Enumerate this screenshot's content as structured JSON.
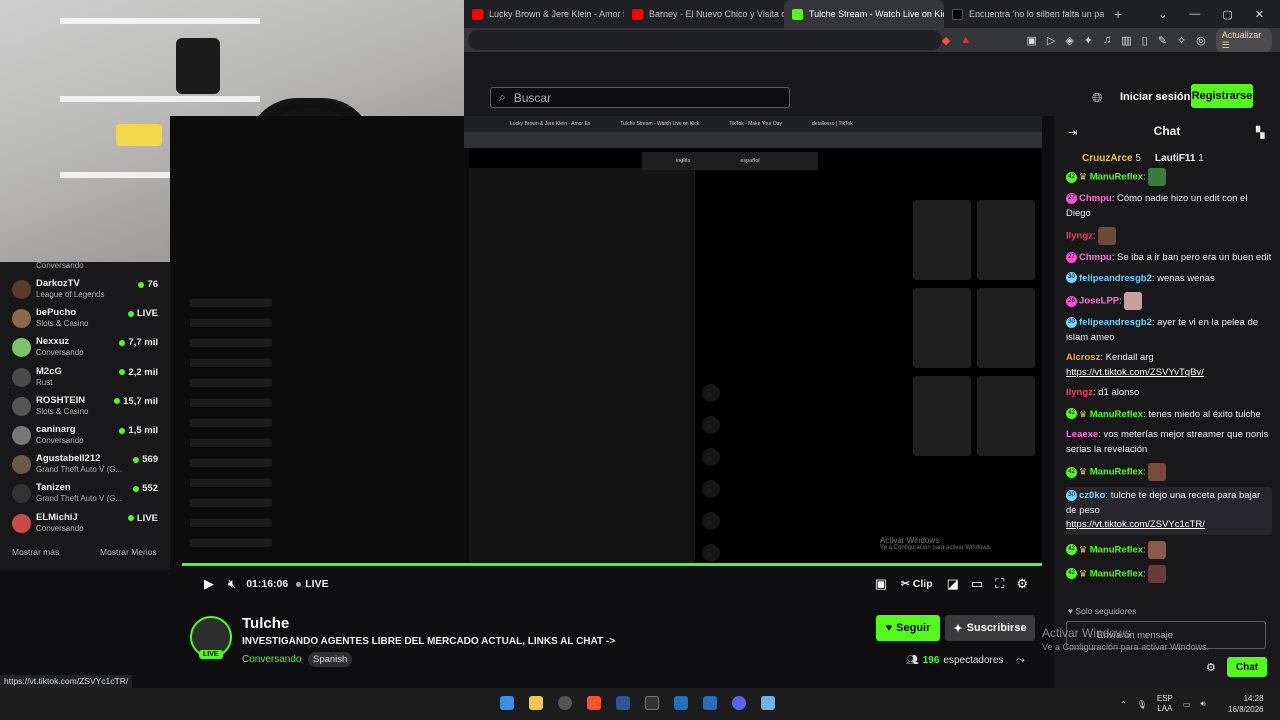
{
  "browser": {
    "tabs": [
      {
        "label": "Lucky Brown & Jere Klein - Amor Es",
        "color": "#ff0000"
      },
      {
        "label": "Barney - El Nuevo Chico y Visita de",
        "color": "#ff0000"
      },
      {
        "label": "Tulche Stream - Watch Live on Kick",
        "color": "#53fc18"
      },
      {
        "label": "Encuentra 'no lo silben falta un part",
        "color": "#000000"
      }
    ],
    "update_label": "Actualizar"
  },
  "topnav": {
    "search_placeholder": "Buscar",
    "login_label": "Iniciar sesión",
    "register_label": "Registrarse"
  },
  "sidebar": {
    "first_cat": "Conversando",
    "items": [
      {
        "name": "DarkozTV",
        "category": "League of Legends",
        "viewers": "76"
      },
      {
        "name": "bePucho",
        "category": "Slots & Casino",
        "viewers": "LIVE"
      },
      {
        "name": "Nexxuz",
        "category": "Conversando",
        "viewers": "7,7 mil"
      },
      {
        "name": "M2cG",
        "category": "Rust",
        "viewers": "2,2 mil"
      },
      {
        "name": "ROSHTEIN",
        "category": "Slots & Casino",
        "viewers": "15,7 mil"
      },
      {
        "name": "caninarg",
        "category": "Conversando",
        "viewers": "1,5 mil"
      },
      {
        "name": "Agustabell212",
        "category": "Grand Theft Auto V (G...",
        "viewers": "569"
      },
      {
        "name": "Tanizen",
        "category": "Grand Theft Auto V (G...",
        "viewers": "552"
      },
      {
        "name": "ELMichiJ",
        "category": "Conversando",
        "viewers": "LIVE"
      }
    ],
    "show_more": "Mostrar más",
    "show_less": "Mostrar Menos"
  },
  "video_inner": {
    "tabs": [
      "Lucky Brown & Jere Klein - Amor Es",
      "Tulche Stream - Watch Live on Kick",
      "TikTok - Make Your Day",
      "detallosso | TikTok"
    ],
    "toggle_left": "inglés",
    "toggle_right": "español",
    "activate_title": "Activar Windows",
    "activate_sub": "Ve a Configuración para activar Windows."
  },
  "player": {
    "time": "01:16:06",
    "live_label": "LIVE",
    "clip_label": "Clip"
  },
  "stream": {
    "name": "Tulche",
    "title": "INVESTIGANDO AGENTES LIBRE DEL MERCADO ACTUAL, LINKS AL CHAT ->",
    "category": "Conversando",
    "language": "Spanish",
    "live_badge": "LIVE",
    "follow_label": "Seguir",
    "subscribe_label": "Suscribirse",
    "viewers_count": "196",
    "viewers_label": "espectadores"
  },
  "chat": {
    "header": "Chat",
    "pinned": [
      {
        "rank": "1",
        "name": "CruuzArce",
        "count": "5"
      },
      {
        "rank": "2",
        "name": "LautiF11",
        "count": "1"
      }
    ],
    "messages": [
      {
        "badge": "42",
        "badge_color": "g",
        "user": "ManuReflex",
        "color": "#53fc18",
        "text": "",
        "emote": true
      },
      {
        "badge": "27",
        "badge_color": "p",
        "user": "Chmpu",
        "color": "#ff6fd8",
        "text": "Cómo nadie hizo un edit con el Diego"
      },
      {
        "badge": "",
        "badge_color": "",
        "user": "Ilyngz",
        "color": "#ff3b5c",
        "text": "",
        "emote": true
      },
      {
        "badge": "27",
        "badge_color": "p",
        "user": "Chmpu",
        "color": "#ff6fd8",
        "text": "Se iba a ir ban pero era un buen edit"
      },
      {
        "badge": "30",
        "badge_color": "b",
        "user": "felipeandresgb2",
        "color": "#6ad6ff",
        "text": "wenas wenas"
      },
      {
        "badge": "26",
        "badge_color": "p",
        "user": "JoseLPP",
        "color": "#ff6fd8",
        "text": "",
        "emote": true
      },
      {
        "badge": "30",
        "badge_color": "b",
        "user": "felipeandresgb2",
        "color": "#6ad6ff",
        "text": "ayer te vi en la pelea de islam ameo"
      },
      {
        "badge": "",
        "badge_color": "",
        "user": "Alcrosz",
        "color": "#f4a14a",
        "text": "Kendall arg",
        "link": "https://vt.tiktok.com/ZSVYvTqBv/"
      },
      {
        "badge": "",
        "badge_color": "",
        "user": "Ilyngz",
        "color": "#ff3b5c",
        "text": "d1 alonso"
      },
      {
        "badge": "42",
        "badge_color": "g",
        "user": "ManuReflex",
        "color": "#53fc18",
        "text": "tenes miedo al éxito tulche"
      },
      {
        "badge": "",
        "badge_color": "",
        "user": "Leaexe",
        "color": "#ff6fd8",
        "text": "vos meterías mejor streamer que nonis serias la revelación"
      },
      {
        "badge": "42",
        "badge_color": "g",
        "user": "ManuReflex",
        "color": "#53fc18",
        "text": "",
        "emote": true
      },
      {
        "badge": "30",
        "badge_color": "b",
        "user": "cz0ko",
        "color": "#6ad6ff",
        "text": "tulche te dejo una receta para bajar de peso",
        "link": "https://vt.tiktok.com/ZSVYc1cTR/",
        "highlight": true
      },
      {
        "badge": "42",
        "badge_color": "g",
        "user": "ManuReflex",
        "color": "#53fc18",
        "text": "",
        "emote": true
      },
      {
        "badge": "42",
        "badge_color": "g",
        "user": "ManuReflex",
        "color": "#53fc18",
        "text": "",
        "emote": true
      }
    ],
    "followers_only": "Solo seguidores",
    "input_placeholder": "Envía un mensaje",
    "send_label": "Chat"
  },
  "overlay": {
    "activate_title": "Activar Windows",
    "activate_sub": "Ve a Configuración para activar Windows."
  },
  "status_url": "https://vt.tiktok.com/ZSVYc1cTR/",
  "taskbar": {
    "lang1": "ESP",
    "lang2": "LAA",
    "time": "14:28",
    "date": "16/8/2026"
  }
}
